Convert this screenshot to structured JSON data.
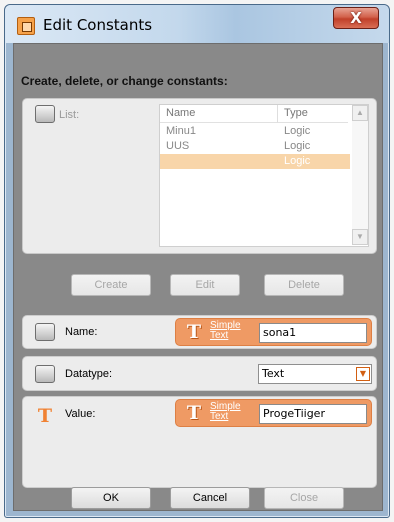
{
  "window": {
    "title": "Edit Constants",
    "close_label": "X"
  },
  "heading": "Create, delete, or change constants:",
  "list": {
    "label": "List:",
    "columns": [
      "Name",
      "Type"
    ],
    "rows": [
      {
        "name": "Minu1",
        "type": "Logic",
        "selected": false
      },
      {
        "name": "UUS",
        "type": "Logic",
        "selected": false
      },
      {
        "name": "",
        "type": "Logic",
        "selected": true
      }
    ],
    "scroll_up_icon": "triangle-up",
    "scroll_down_icon": "triangle-down"
  },
  "list_buttons": {
    "create": "Create",
    "edit": "Edit",
    "delete": "Delete"
  },
  "name_field": {
    "label": "Name:",
    "type_link_line1": "Simple",
    "type_link_line2": "Text",
    "value": "sona1"
  },
  "datatype_field": {
    "label": "Datatype:",
    "value": "Text"
  },
  "value_field": {
    "label": "Value:",
    "type_link_line1": "Simple",
    "type_link_line2": "Text",
    "value": "ProgeTiiger"
  },
  "dialog_buttons": {
    "ok": "OK",
    "cancel": "Cancel",
    "close": "Close"
  },
  "colors": {
    "accent": "#ef9a64",
    "selection": "#f8d5a9",
    "close_button": "#c1402a"
  }
}
